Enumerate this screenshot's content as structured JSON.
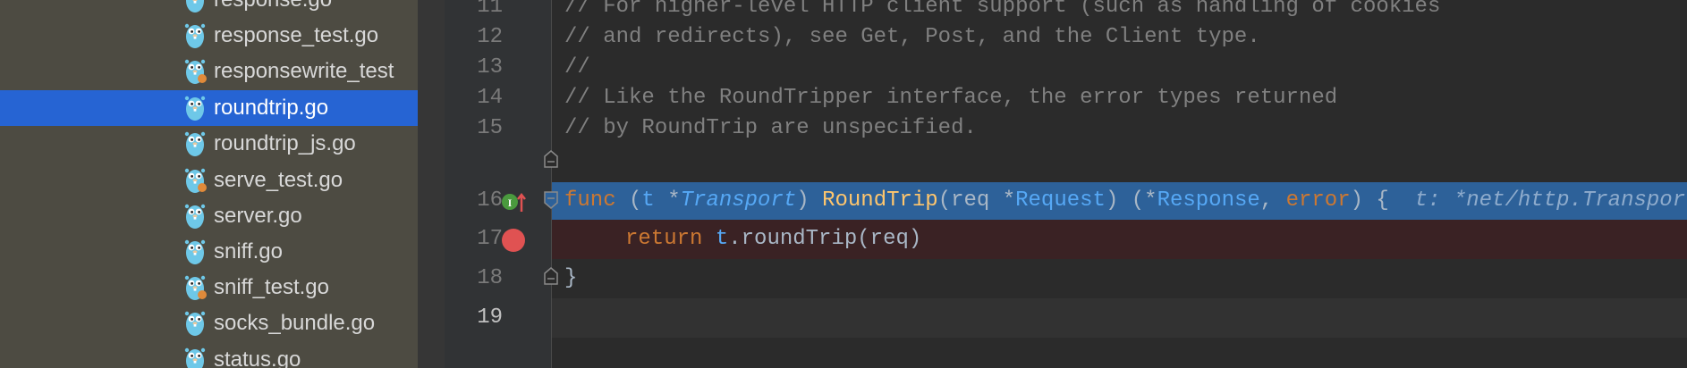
{
  "project_tree": {
    "files": [
      {
        "name": "response.go",
        "selected": false
      },
      {
        "name": "response_test.go",
        "selected": false
      },
      {
        "name": "responsewrite_test",
        "selected": false
      },
      {
        "name": "roundtrip.go",
        "selected": true
      },
      {
        "name": "roundtrip_js.go",
        "selected": false
      },
      {
        "name": "serve_test.go",
        "selected": false
      },
      {
        "name": "server.go",
        "selected": false
      },
      {
        "name": "sniff.go",
        "selected": false
      },
      {
        "name": "sniff_test.go",
        "selected": false
      },
      {
        "name": "socks_bundle.go",
        "selected": false
      },
      {
        "name": "status.go",
        "selected": false
      }
    ]
  },
  "editor": {
    "lines": [
      {
        "num": "11",
        "text": "// For higher-level HTTP client support (such as handling of cookies"
      },
      {
        "num": "12",
        "text": "// and redirects), see Get, Post, and the Client type."
      },
      {
        "num": "13",
        "text": "//"
      },
      {
        "num": "14",
        "text": "// Like the RoundTripper interface, the error types returned"
      },
      {
        "num": "15",
        "text": "// by RoundTrip are unspecified."
      },
      {
        "num": "16",
        "kw_func": "func",
        "p1": " (",
        "recv": "t",
        "p2": " *",
        "recv_type": "Transport",
        "p3": ") ",
        "fname": "RoundTrip",
        "p4": "(req *",
        "param_type": "Request",
        "p5": ") (*",
        "ret_type": "Response",
        "p6": ", ",
        "kw_error": "error",
        "p7": ") {",
        "hint": "t: *net/http.Transport"
      },
      {
        "num": "17",
        "kw_return": "return",
        "p1": " ",
        "recv": "t",
        "p2": ".roundTrip(req)"
      },
      {
        "num": "18",
        "text": "}"
      },
      {
        "num": "19",
        "text": ""
      }
    ]
  },
  "colors": {
    "tree_bg": "#4d4b42",
    "selection": "#2664d3",
    "exec_line": "#2d6199",
    "breakpoint_line": "#3a2224",
    "breakpoint_dot": "#e05252",
    "implements_icon": "#4a9a3e",
    "arrow_up": "#e05252"
  },
  "icons": {
    "file_icon": "go-gopher-icon",
    "breakpoint": "breakpoint-icon",
    "implements": "implements-marker-icon",
    "fold": "fold-marker-icon"
  }
}
